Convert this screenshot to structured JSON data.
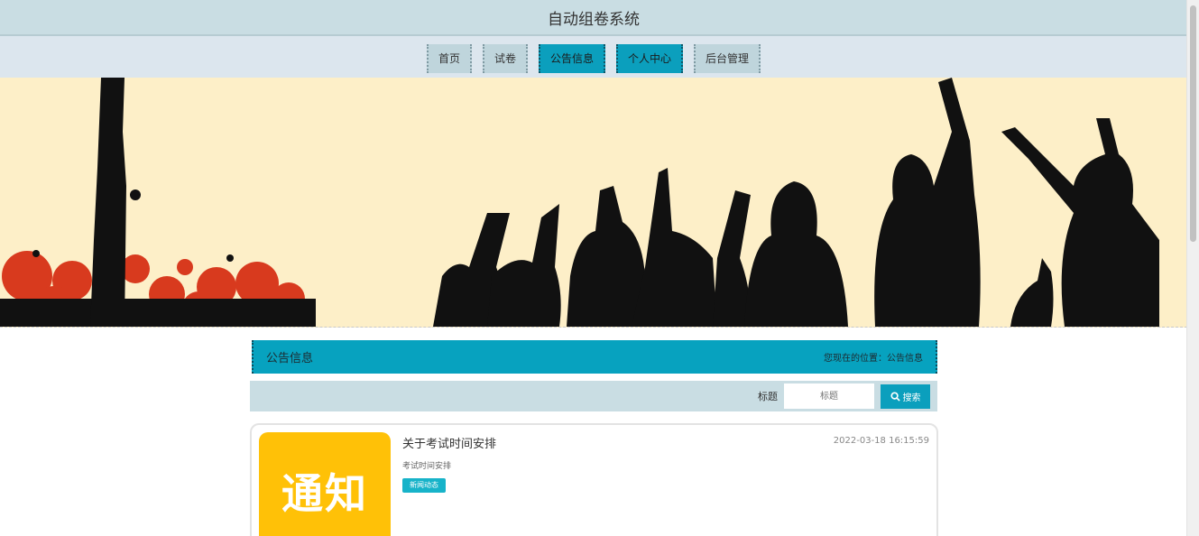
{
  "app": {
    "title": "自动组卷系统"
  },
  "nav": {
    "items": [
      {
        "label": "首页",
        "active": false
      },
      {
        "label": "试卷",
        "active": false
      },
      {
        "label": "公告信息",
        "active": true
      },
      {
        "label": "个人中心",
        "active": true
      },
      {
        "label": "后台管理",
        "active": false
      }
    ]
  },
  "section": {
    "title": "公告信息",
    "location": "您现在的位置：公告信息"
  },
  "search": {
    "label": "标题",
    "placeholder": "标题",
    "button": "搜索"
  },
  "news": [
    {
      "title": "关于考试时间安排",
      "date": "2022-03-18 16:15:59",
      "desc": "考试时间安排",
      "tag": "新闻动态",
      "thumb_text": "通知"
    }
  ],
  "colors": {
    "accent": "#0b9fbd",
    "header_bg": "#c9dde3",
    "nav_bg": "#dce6ee",
    "banner_bg": "#fdefc8",
    "thumb_bg": "#ffc107"
  }
}
